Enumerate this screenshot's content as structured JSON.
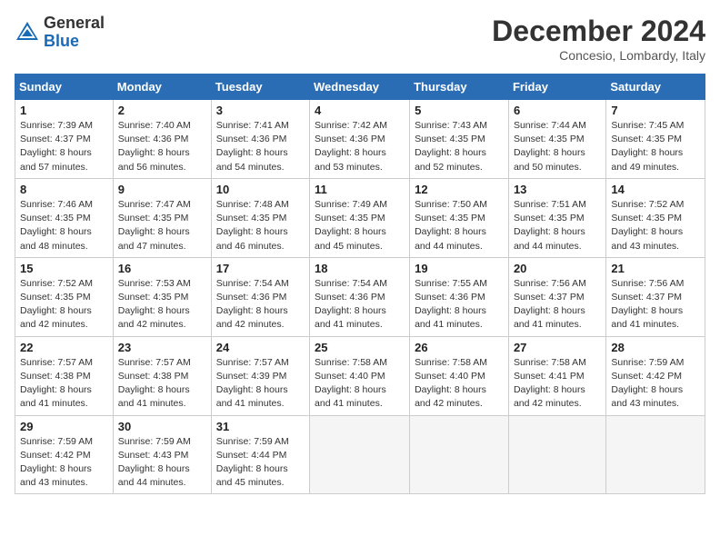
{
  "header": {
    "logo_general": "General",
    "logo_blue": "Blue",
    "month_title": "December 2024",
    "location": "Concesio, Lombardy, Italy"
  },
  "weekdays": [
    "Sunday",
    "Monday",
    "Tuesday",
    "Wednesday",
    "Thursday",
    "Friday",
    "Saturday"
  ],
  "weeks": [
    [
      {
        "day": "1",
        "sunrise": "Sunrise: 7:39 AM",
        "sunset": "Sunset: 4:37 PM",
        "daylight": "Daylight: 8 hours and 57 minutes."
      },
      {
        "day": "2",
        "sunrise": "Sunrise: 7:40 AM",
        "sunset": "Sunset: 4:36 PM",
        "daylight": "Daylight: 8 hours and 56 minutes."
      },
      {
        "day": "3",
        "sunrise": "Sunrise: 7:41 AM",
        "sunset": "Sunset: 4:36 PM",
        "daylight": "Daylight: 8 hours and 54 minutes."
      },
      {
        "day": "4",
        "sunrise": "Sunrise: 7:42 AM",
        "sunset": "Sunset: 4:36 PM",
        "daylight": "Daylight: 8 hours and 53 minutes."
      },
      {
        "day": "5",
        "sunrise": "Sunrise: 7:43 AM",
        "sunset": "Sunset: 4:35 PM",
        "daylight": "Daylight: 8 hours and 52 minutes."
      },
      {
        "day": "6",
        "sunrise": "Sunrise: 7:44 AM",
        "sunset": "Sunset: 4:35 PM",
        "daylight": "Daylight: 8 hours and 50 minutes."
      },
      {
        "day": "7",
        "sunrise": "Sunrise: 7:45 AM",
        "sunset": "Sunset: 4:35 PM",
        "daylight": "Daylight: 8 hours and 49 minutes."
      }
    ],
    [
      {
        "day": "8",
        "sunrise": "Sunrise: 7:46 AM",
        "sunset": "Sunset: 4:35 PM",
        "daylight": "Daylight: 8 hours and 48 minutes."
      },
      {
        "day": "9",
        "sunrise": "Sunrise: 7:47 AM",
        "sunset": "Sunset: 4:35 PM",
        "daylight": "Daylight: 8 hours and 47 minutes."
      },
      {
        "day": "10",
        "sunrise": "Sunrise: 7:48 AM",
        "sunset": "Sunset: 4:35 PM",
        "daylight": "Daylight: 8 hours and 46 minutes."
      },
      {
        "day": "11",
        "sunrise": "Sunrise: 7:49 AM",
        "sunset": "Sunset: 4:35 PM",
        "daylight": "Daylight: 8 hours and 45 minutes."
      },
      {
        "day": "12",
        "sunrise": "Sunrise: 7:50 AM",
        "sunset": "Sunset: 4:35 PM",
        "daylight": "Daylight: 8 hours and 44 minutes."
      },
      {
        "day": "13",
        "sunrise": "Sunrise: 7:51 AM",
        "sunset": "Sunset: 4:35 PM",
        "daylight": "Daylight: 8 hours and 44 minutes."
      },
      {
        "day": "14",
        "sunrise": "Sunrise: 7:52 AM",
        "sunset": "Sunset: 4:35 PM",
        "daylight": "Daylight: 8 hours and 43 minutes."
      }
    ],
    [
      {
        "day": "15",
        "sunrise": "Sunrise: 7:52 AM",
        "sunset": "Sunset: 4:35 PM",
        "daylight": "Daylight: 8 hours and 42 minutes."
      },
      {
        "day": "16",
        "sunrise": "Sunrise: 7:53 AM",
        "sunset": "Sunset: 4:35 PM",
        "daylight": "Daylight: 8 hours and 42 minutes."
      },
      {
        "day": "17",
        "sunrise": "Sunrise: 7:54 AM",
        "sunset": "Sunset: 4:36 PM",
        "daylight": "Daylight: 8 hours and 42 minutes."
      },
      {
        "day": "18",
        "sunrise": "Sunrise: 7:54 AM",
        "sunset": "Sunset: 4:36 PM",
        "daylight": "Daylight: 8 hours and 41 minutes."
      },
      {
        "day": "19",
        "sunrise": "Sunrise: 7:55 AM",
        "sunset": "Sunset: 4:36 PM",
        "daylight": "Daylight: 8 hours and 41 minutes."
      },
      {
        "day": "20",
        "sunrise": "Sunrise: 7:56 AM",
        "sunset": "Sunset: 4:37 PM",
        "daylight": "Daylight: 8 hours and 41 minutes."
      },
      {
        "day": "21",
        "sunrise": "Sunrise: 7:56 AM",
        "sunset": "Sunset: 4:37 PM",
        "daylight": "Daylight: 8 hours and 41 minutes."
      }
    ],
    [
      {
        "day": "22",
        "sunrise": "Sunrise: 7:57 AM",
        "sunset": "Sunset: 4:38 PM",
        "daylight": "Daylight: 8 hours and 41 minutes."
      },
      {
        "day": "23",
        "sunrise": "Sunrise: 7:57 AM",
        "sunset": "Sunset: 4:38 PM",
        "daylight": "Daylight: 8 hours and 41 minutes."
      },
      {
        "day": "24",
        "sunrise": "Sunrise: 7:57 AM",
        "sunset": "Sunset: 4:39 PM",
        "daylight": "Daylight: 8 hours and 41 minutes."
      },
      {
        "day": "25",
        "sunrise": "Sunrise: 7:58 AM",
        "sunset": "Sunset: 4:40 PM",
        "daylight": "Daylight: 8 hours and 41 minutes."
      },
      {
        "day": "26",
        "sunrise": "Sunrise: 7:58 AM",
        "sunset": "Sunset: 4:40 PM",
        "daylight": "Daylight: 8 hours and 42 minutes."
      },
      {
        "day": "27",
        "sunrise": "Sunrise: 7:58 AM",
        "sunset": "Sunset: 4:41 PM",
        "daylight": "Daylight: 8 hours and 42 minutes."
      },
      {
        "day": "28",
        "sunrise": "Sunrise: 7:59 AM",
        "sunset": "Sunset: 4:42 PM",
        "daylight": "Daylight: 8 hours and 43 minutes."
      }
    ],
    [
      {
        "day": "29",
        "sunrise": "Sunrise: 7:59 AM",
        "sunset": "Sunset: 4:42 PM",
        "daylight": "Daylight: 8 hours and 43 minutes."
      },
      {
        "day": "30",
        "sunrise": "Sunrise: 7:59 AM",
        "sunset": "Sunset: 4:43 PM",
        "daylight": "Daylight: 8 hours and 44 minutes."
      },
      {
        "day": "31",
        "sunrise": "Sunrise: 7:59 AM",
        "sunset": "Sunset: 4:44 PM",
        "daylight": "Daylight: 8 hours and 45 minutes."
      },
      null,
      null,
      null,
      null
    ]
  ]
}
